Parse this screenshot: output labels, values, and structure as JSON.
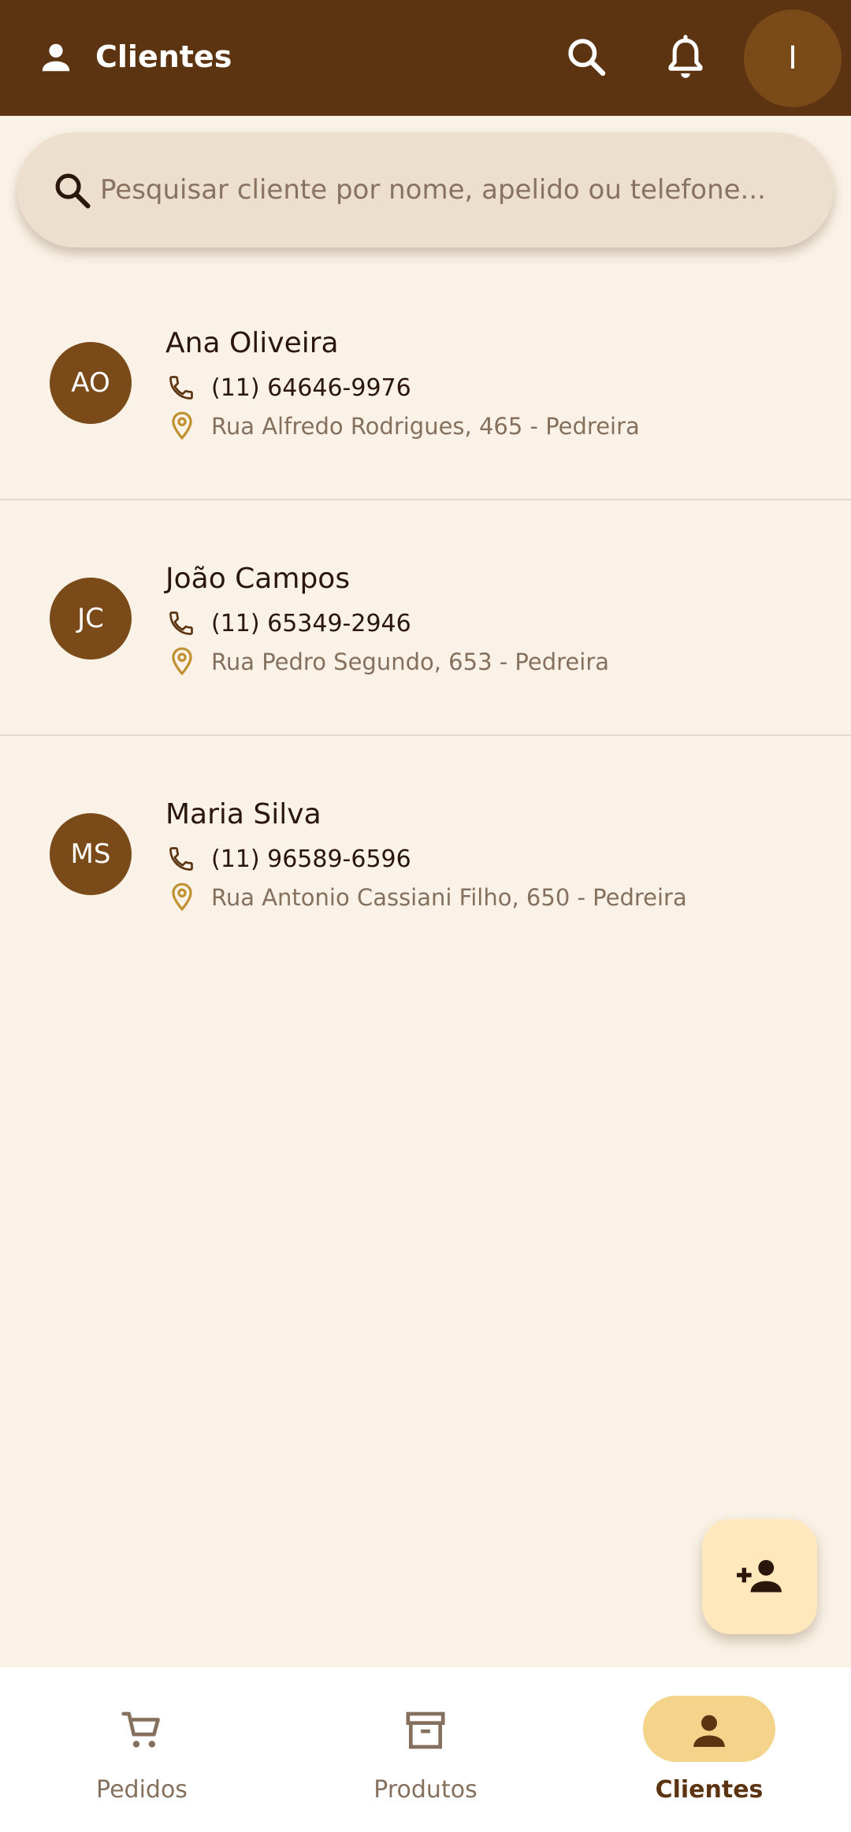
{
  "appbar": {
    "title": "Clientes",
    "avatar_initial": "I"
  },
  "search": {
    "placeholder": "Pesquisar cliente por nome, apelido ou telefone..."
  },
  "clients": [
    {
      "initials": "AO",
      "name": "Ana Oliveira",
      "phone": "(11) 64646-9976",
      "address": "Rua Alfredo Rodrigues, 465 - Pedreira"
    },
    {
      "initials": "JC",
      "name": "João Campos",
      "phone": "(11) 65349-2946",
      "address": "Rua Pedro Segundo, 653 - Pedreira"
    },
    {
      "initials": "MS",
      "name": "Maria Silva",
      "phone": "(11) 96589-6596",
      "address": "Rua Antonio Cassiani Filho, 650 - Pedreira"
    }
  ],
  "bottom_nav": {
    "items": [
      {
        "label": "Pedidos",
        "icon": "cart-icon",
        "active": false
      },
      {
        "label": "Produtos",
        "icon": "archive-box-icon",
        "active": false
      },
      {
        "label": "Clientes",
        "icon": "person-icon",
        "active": true
      }
    ]
  },
  "colors": {
    "appbar": "#5C3411",
    "background": "#FAF2E6",
    "avatar": "#7A4A19",
    "fab": "#FFE9BC",
    "active_pill": "#F3D48A",
    "pin": "#C0902E"
  }
}
